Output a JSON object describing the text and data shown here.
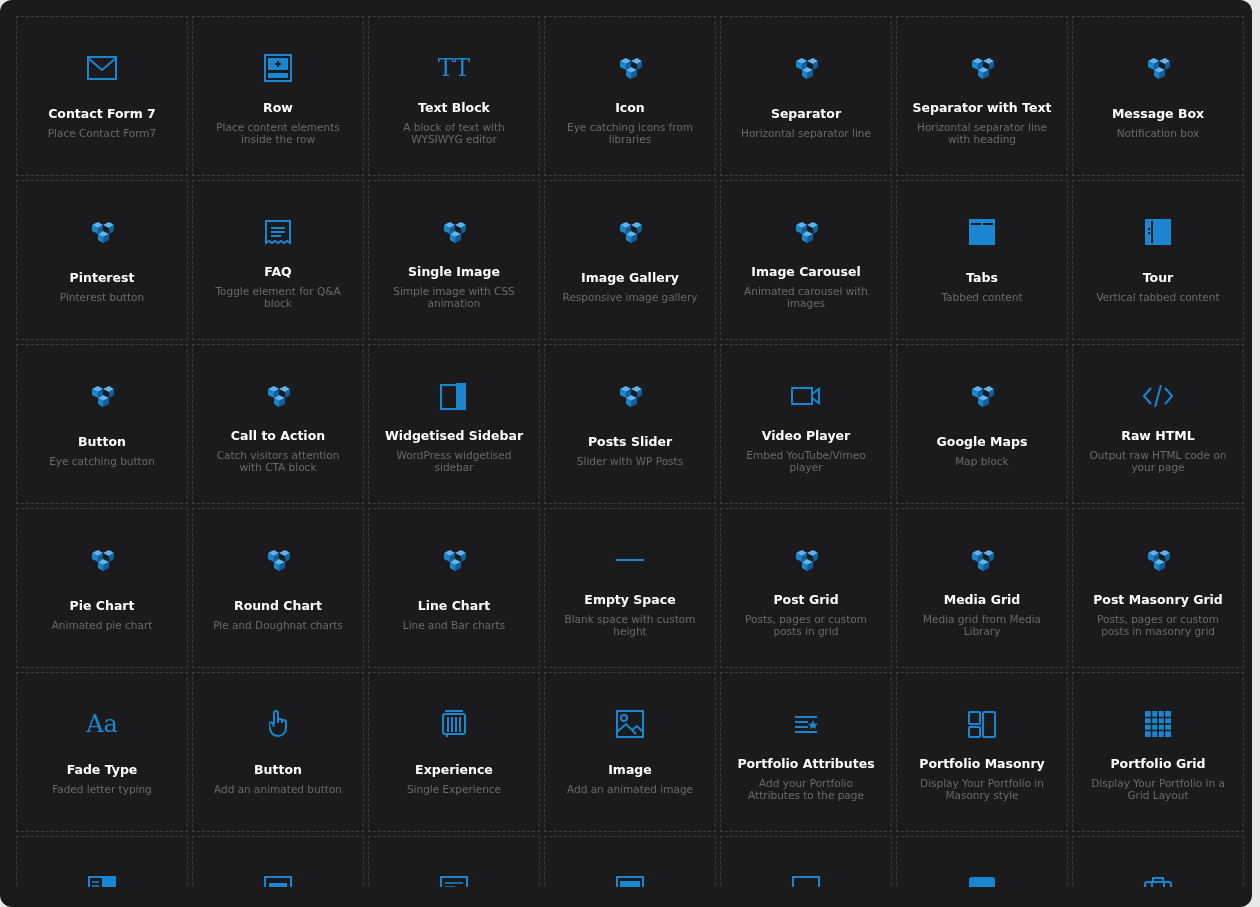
{
  "elements": [
    {
      "title": "Contact Form 7",
      "description": "Place Contact Form7",
      "kind": "envelope"
    },
    {
      "title": "Row",
      "description": "Place content elements inside the row",
      "kind": "row"
    },
    {
      "title": "Text Block",
      "description": "A block of text with WYSIWYG editor",
      "kind": "glyph",
      "icon_text": "TT"
    },
    {
      "title": "Icon",
      "description": "Eye catching icons from libraries",
      "kind": "cubes"
    },
    {
      "title": "Separator",
      "description": "Horizontal separator line",
      "kind": "cubes"
    },
    {
      "title": "Separator with Text",
      "description": "Horizontal separator line with heading",
      "kind": "cubes"
    },
    {
      "title": "Message Box",
      "description": "Notification box",
      "kind": "cubes"
    },
    {
      "title": "Pinterest",
      "description": "Pinterest button",
      "kind": "cubes"
    },
    {
      "title": "FAQ",
      "description": "Toggle element for Q&A block",
      "kind": "faq"
    },
    {
      "title": "Single Image",
      "description": "Simple image with CSS animation",
      "kind": "cubes"
    },
    {
      "title": "Image Gallery",
      "description": "Responsive image gallery",
      "kind": "cubes"
    },
    {
      "title": "Image Carousel",
      "description": "Animated carousel with images",
      "kind": "cubes"
    },
    {
      "title": "Tabs",
      "description": "Tabbed content",
      "kind": "tabs"
    },
    {
      "title": "Tour",
      "description": "Vertical tabbed content",
      "kind": "tour"
    },
    {
      "title": "Button",
      "description": "Eye catching button",
      "kind": "cubes"
    },
    {
      "title": "Call to Action",
      "description": "Catch visitors attention with CTA block",
      "kind": "cubes"
    },
    {
      "title": "Widgetised Sidebar",
      "description": "WordPress widgetised sidebar",
      "kind": "sidebar"
    },
    {
      "title": "Posts Slider",
      "description": "Slider with WP Posts",
      "kind": "cubes"
    },
    {
      "title": "Video Player",
      "description": "Embed YouTube/Vimeo player",
      "kind": "video"
    },
    {
      "title": "Google Maps",
      "description": "Map block",
      "kind": "cubes"
    },
    {
      "title": "Raw HTML",
      "description": "Output raw HTML code on your page",
      "kind": "code"
    },
    {
      "title": "Pie Chart",
      "description": "Animated pie chart",
      "kind": "cubes"
    },
    {
      "title": "Round Chart",
      "description": "Pie and Doughnat charts",
      "kind": "cubes"
    },
    {
      "title": "Line Chart",
      "description": "Line and Bar charts",
      "kind": "cubes"
    },
    {
      "title": "Empty Space",
      "description": "Blank space with custom height",
      "kind": "line"
    },
    {
      "title": "Post Grid",
      "description": "Posts, pages or custom posts in grid",
      "kind": "cubes"
    },
    {
      "title": "Media Grid",
      "description": "Media grid from Media Library",
      "kind": "cubes"
    },
    {
      "title": "Post Masonry Grid",
      "description": "Posts, pages or custom posts in masonry grid",
      "kind": "cubes"
    },
    {
      "title": "Fade Type",
      "description": "Faded letter typing",
      "kind": "glyph",
      "icon_text": "Aa"
    },
    {
      "title": "Button",
      "description": "Add an animated button",
      "kind": "hand"
    },
    {
      "title": "Experience",
      "description": "Single Experience",
      "kind": "experience"
    },
    {
      "title": "Image",
      "description": "Add an animated image",
      "kind": "image"
    },
    {
      "title": "Portfolio Attributes",
      "description": "Add your Portfolio Attributes to the page",
      "kind": "attributes"
    },
    {
      "title": "Portfolio Masonry",
      "description": "Display Your Portfolio in Masonry style",
      "kind": "masonry"
    },
    {
      "title": "Portfolio Grid",
      "description": "Display Your Portfolio in a Grid Layout",
      "kind": "grid"
    },
    {
      "kind": "listcard"
    },
    {
      "kind": "browser"
    },
    {
      "kind": "card"
    },
    {
      "kind": "imagecard"
    },
    {
      "kind": "frame"
    },
    {
      "kind": "photo"
    },
    {
      "kind": "briefcase"
    }
  ]
}
